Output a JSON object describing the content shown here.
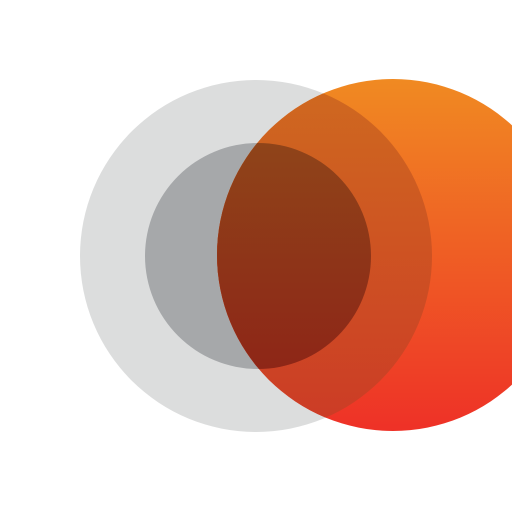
{
  "logo": {
    "icon": "overlapping-circles-logo-icon",
    "colors": {
      "background": "#ffffff",
      "outer_gray": "#dcdddd",
      "inner_gray": "#a6a8aa",
      "orange_top": "#f08a22",
      "orange_bottom": "#ee3127",
      "overlap_outer_top": "#cf6a1f",
      "overlap_outer_bottom": "#cc3a26",
      "overlap_inner_top": "#8f4419",
      "overlap_inner_bottom": "#8e2617"
    }
  }
}
